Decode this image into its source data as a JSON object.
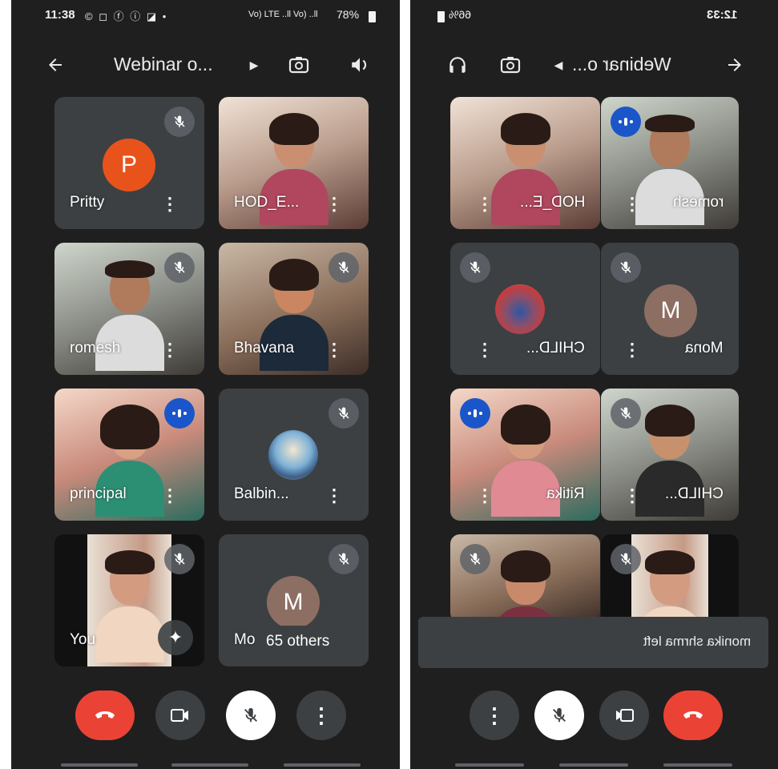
{
  "left_phone": {
    "status": {
      "time": "11:38",
      "status_icons": "© ◻ ⓕ ⓘ ◪ •",
      "network": "Vo) LTE ..ll Vo) ..ll",
      "battery": "78%"
    },
    "app_bar": {
      "title": "Webinar o..."
    },
    "participants": [
      {
        "name": "Pritty",
        "avatar_letter": "P",
        "avatar_color": "#e8531c",
        "muted": true
      },
      {
        "name": "HOD_E...",
        "muted": false
      },
      {
        "name": "romesh",
        "muted": true
      },
      {
        "name": "Bhavana",
        "muted": true
      },
      {
        "name": "principal",
        "speaking": true
      },
      {
        "name": "Balbin...",
        "muted": true
      },
      {
        "name": "You",
        "muted": true
      },
      {
        "name": "Mo",
        "avatar_letter": "M",
        "avatar_color": "#8d6e63",
        "muted": true
      }
    ],
    "others_label": "65 others"
  },
  "right_phone": {
    "status": {
      "time": "12:33",
      "battery": "66%"
    },
    "app_bar": {
      "title": "Webinar o..."
    },
    "participants": [
      {
        "name": "HOD_E...",
        "muted": false
      },
      {
        "name": "romesh",
        "speaking": true
      },
      {
        "name": "CHILD...",
        "muted": true
      },
      {
        "name": "Mona",
        "avatar_letter": "M",
        "avatar_color": "#8d6e63",
        "muted": true
      },
      {
        "name": "Ritika",
        "speaking": true
      },
      {
        "name": "CHILD...",
        "muted": true
      }
    ],
    "toast": "monika shrma left"
  },
  "colors": {
    "background": "#1f1f1f",
    "tile": "#3c4043",
    "end_call": "#ea4335",
    "speaking": "#1a56c9"
  }
}
